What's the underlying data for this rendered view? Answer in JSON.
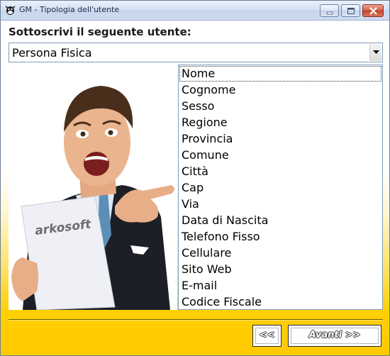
{
  "window": {
    "title": "GM - Tipologia dell'utente",
    "app_icon": "cow-icon"
  },
  "form": {
    "prompt": "Sottoscrivi il seguente utente:",
    "user_type": {
      "selected": "Persona Fisica",
      "icon": "chevron-down-icon"
    }
  },
  "photo": {
    "brand_text": "arkosoft"
  },
  "fields_list": {
    "items": [
      "Nome",
      "Cognome",
      "Sesso",
      "Regione",
      "Provincia",
      "Comune",
      "Città",
      "Cap",
      "Via",
      "Data di Nascita",
      "Telefono Fisso",
      "Cellulare",
      "Sito Web",
      "E-mail",
      "Codice Fiscale"
    ],
    "focused_index": 0
  },
  "navigation": {
    "back_label": "<<",
    "next_label": "Avanti >>"
  },
  "colors": {
    "accent_yellow": "#ffcc00",
    "border_blue": "#7f9db9"
  }
}
